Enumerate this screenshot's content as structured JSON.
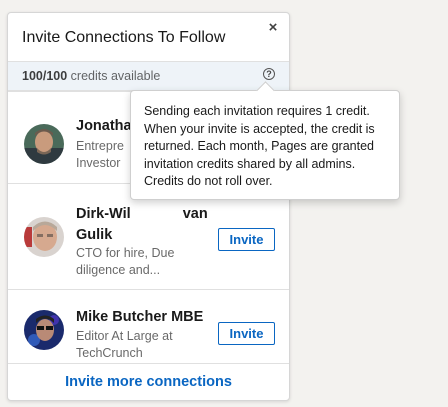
{
  "panel": {
    "title": "Invite Connections To Follow",
    "close_icon": "×"
  },
  "credits": {
    "used": "100/100",
    "label": "credits available",
    "help_icon": "?"
  },
  "tooltip": {
    "text": "Sending each invitation requires 1 credit. When your invite is accepted, the credit is returned. Each month, Pages are granted invitation credits shared by all admins. Credits do not roll over."
  },
  "connections": [
    {
      "name": "Jonatha",
      "headline_1": "Entrepre",
      "headline_2": "Investor"
    },
    {
      "name_1": "Dirk-Wil",
      "name_1b": "van",
      "name_2": "Gulik",
      "headline_1": "CTO for hire, Due",
      "headline_2": "diligence and...",
      "invite_label": "Invite"
    },
    {
      "name": "Mike Butcher MBE",
      "headline_1": "Editor At Large at",
      "headline_2": "TechCrunch",
      "invite_label": "Invite"
    }
  ],
  "footer": {
    "link": "Invite more connections"
  },
  "colors": {
    "accent": "#0a66c2",
    "credits_bg": "#eef3f8"
  }
}
